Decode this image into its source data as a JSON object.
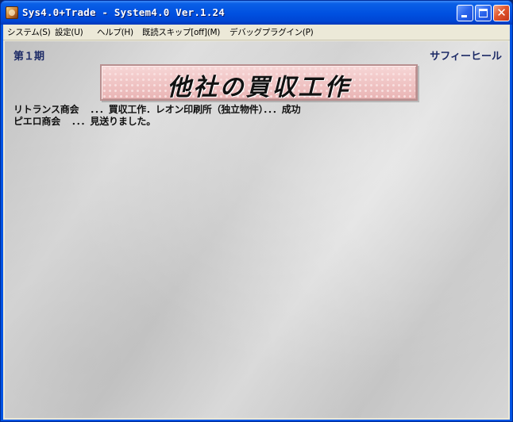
{
  "window": {
    "title": "Sys4.0+Trade - System4.0 Ver.1.24",
    "controls": {
      "minimize": "",
      "maximize": "",
      "close": "✕"
    }
  },
  "menu": {
    "items": [
      {
        "label": "システム(S)"
      },
      {
        "label": "設定(U)"
      },
      {
        "label": "ヘルプ(H)"
      },
      {
        "label": "既読スキップ[off](M)"
      },
      {
        "label": "デバッグプラグイン(P)"
      }
    ]
  },
  "game": {
    "period": "第１期",
    "company": "サフィーヒール",
    "banner_title": "他社の買収工作",
    "log": [
      {
        "company": "リトランス商会",
        "result": "．．．買収工作．レオン印刷所（独立物件）．．．成功"
      },
      {
        "company": "ピエロ商会",
        "result": "．．．見送りました。"
      }
    ]
  },
  "colors": {
    "titlebar": "#0054e3",
    "menubar": "#ece9d8",
    "accent_text": "#1c2a66",
    "banner": "#f1c6c6"
  },
  "icons": {
    "app": "app-icon",
    "minimize": "minimize-icon",
    "maximize": "maximize-icon",
    "close": "close-icon"
  }
}
